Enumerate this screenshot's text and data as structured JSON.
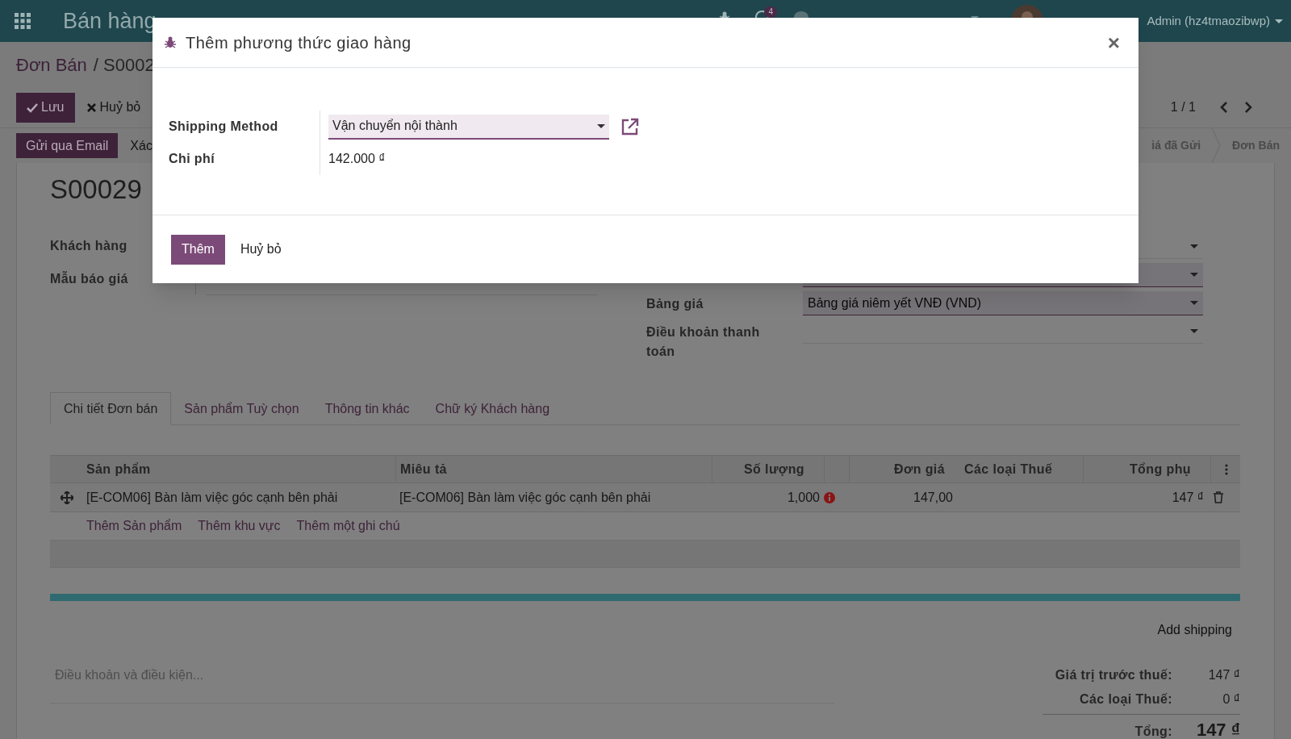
{
  "top_bar": {
    "app_title": "Bán hàng",
    "messages_badge": "4",
    "user": "Admin (hz4tmaozibwp)"
  },
  "breadcrumb": {
    "parent": "Đơn Bán",
    "current": "/ S0002"
  },
  "actions": [
    {
      "label": "Lưu",
      "kind": "primary"
    },
    {
      "label": "Huỷ bỏ",
      "kind": "secondary"
    }
  ],
  "pager": "1 / 1",
  "status_actions": [
    {
      "label": "Gửi qua Email",
      "kind": "primary"
    },
    {
      "label": "Xác",
      "kind": "secondary"
    }
  ],
  "status_steps": [
    {
      "label": "iá đã Gửi",
      "selected": false
    },
    {
      "label": "Đơn Bán",
      "selected": false
    }
  ],
  "sheet": {
    "name": "S00029",
    "left_fields": [
      {
        "label": "Khách hàng",
        "kind": "hidden"
      },
      {
        "label": "Mẫu báo giá",
        "kind": "select"
      }
    ],
    "right_fields": [
      {
        "required": false
      },
      {
        "required": true
      },
      {
        "label": "Bảng giá",
        "value": "Bảng giá niêm yết VNĐ (VND)",
        "required": true
      },
      {
        "label": "Điều khoản thanh toán",
        "required": false
      }
    ]
  },
  "tabs": [
    {
      "label": "Chi tiết Đơn bán",
      "selected": true
    },
    {
      "label": "Sản phẩm Tuỳ chọn",
      "selected": false
    },
    {
      "label": "Thông tin khác",
      "selected": false
    },
    {
      "label": "Chữ ký Khách hàng",
      "selected": false
    }
  ],
  "order_lines": {
    "columns": [
      "Sản phẩm",
      "Miêu tả",
      "Số lượng",
      "Đơn giá",
      "Các loại Thuế",
      "Tổng phụ"
    ],
    "rows": [
      {
        "product": "[E-COM06] Bàn làm việc góc cạnh bên phải",
        "description": "[E-COM06] Bàn làm việc góc cạnh bên phải",
        "quantity": "1,000",
        "unit_price": "147,00",
        "subtotal": "147 ₫"
      }
    ],
    "add_links": [
      "Thêm Sản phẩm",
      "Thêm khu vực",
      "Thêm một ghi chú"
    ]
  },
  "add_shipping": "Add shipping",
  "terms_placeholder": "Điều khoản và điều kiện...",
  "totals": [
    {
      "label": "Giá trị trước thuế:",
      "value": "147 ₫",
      "kind": "line"
    },
    {
      "label": "Các loại Thuế:",
      "value": "0 ₫",
      "kind": "line"
    },
    {
      "label": "Tổng:",
      "value": "147 ₫",
      "kind": "total"
    }
  ],
  "dialog": {
    "title": "Thêm phương thức giao hàng",
    "close": "×",
    "fields": [
      {
        "label": "Shipping Method",
        "value": "Vận chuyển nội thành",
        "kind": "select"
      },
      {
        "label": "Chi phí",
        "value": "142.000 ₫",
        "kind": "text"
      }
    ],
    "buttons": [
      {
        "label": "Thêm",
        "kind": "primary"
      },
      {
        "label": "Huỷ bỏ",
        "kind": "link"
      }
    ]
  }
}
